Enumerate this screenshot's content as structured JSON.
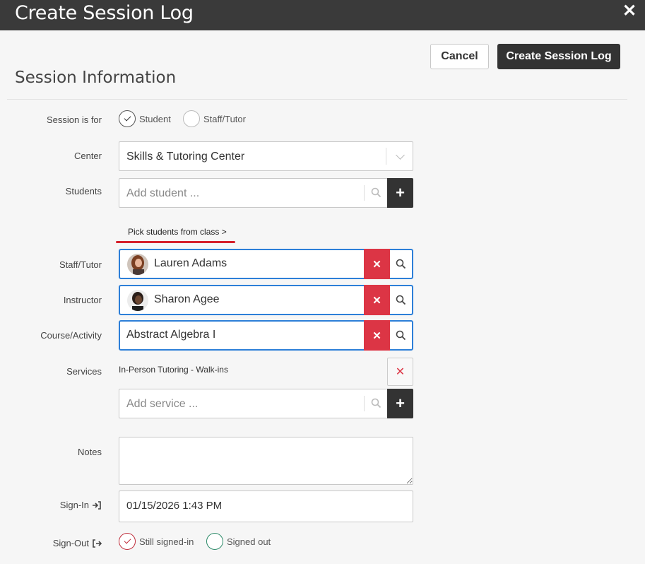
{
  "window": {
    "title": "Create Session Log",
    "close_icon": "close-icon"
  },
  "actions": {
    "cancel_label": "Cancel",
    "create_label": "Create Session Log"
  },
  "section": {
    "title": "Session Information"
  },
  "session_for": {
    "label": "Session is for",
    "options": [
      {
        "label": "Student",
        "selected": true
      },
      {
        "label": "Staff/Tutor",
        "selected": false
      }
    ]
  },
  "center": {
    "label": "Center",
    "value": "Skills & Tutoring Center"
  },
  "students": {
    "label": "Students",
    "placeholder": "Add student ...",
    "pick_link": "Pick students from class >"
  },
  "staff_tutor": {
    "label": "Staff/Tutor",
    "value": "Lauren Adams"
  },
  "instructor": {
    "label": "Instructor",
    "value": "Sharon Agee"
  },
  "course": {
    "label": "Course/Activity",
    "value": "Abstract Algebra I"
  },
  "services": {
    "label": "Services",
    "items": [
      "In-Person Tutoring - Walk-ins"
    ],
    "placeholder": "Add service ..."
  },
  "notes": {
    "label": "Notes",
    "value": ""
  },
  "sign_in": {
    "label": "Sign-In",
    "value": "01/15/2026 1:43 PM"
  },
  "sign_out": {
    "label": "Sign-Out",
    "options": [
      {
        "label": "Still signed-in",
        "selected": true
      },
      {
        "label": "Signed out",
        "selected": false
      }
    ]
  },
  "colors": {
    "accent_blue": "#2d7fd8",
    "danger_red": "#dc3545",
    "dark": "#333333",
    "highlight_red": "#d51f2a"
  }
}
